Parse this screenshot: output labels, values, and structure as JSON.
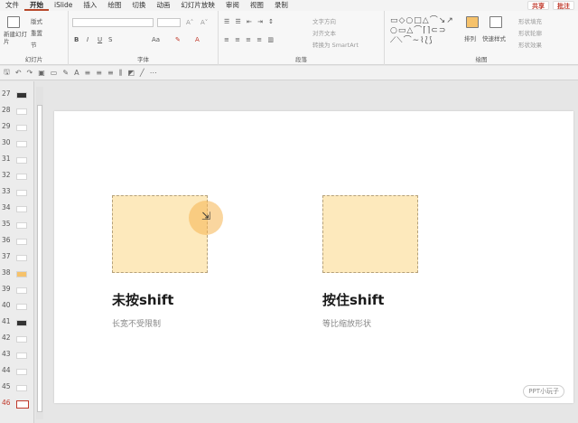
{
  "menu": {
    "items": [
      "文件",
      "开始",
      "iSlide",
      "插入",
      "绘图",
      "切换",
      "动画",
      "幻灯片放映",
      "审阅",
      "视图",
      "录制"
    ],
    "active_index": 1,
    "share": "共享",
    "comment": "批注"
  },
  "ribbon": {
    "slides_group": {
      "new_slide": "新建幻灯片",
      "layout": "版式",
      "reset": "重置",
      "section": "节",
      "label": "幻灯片"
    },
    "font_group": {
      "label": "字体",
      "bold": "B",
      "italic": "I",
      "underline": "U",
      "strike": "S",
      "aa": "Aa"
    },
    "paragraph_group": {
      "text_direction": "文字方向",
      "align_text": "对齐文本",
      "smartart": "转换为 SmartArt",
      "label": "段落"
    },
    "drawing_group": {
      "arrange": "排列",
      "quick_styles": "快速样式",
      "shape_fill": "形状填充",
      "shape_outline": "形状轮廓",
      "shape_effects": "形状效果",
      "label": "绘图"
    }
  },
  "thumbnails": [
    {
      "num": "27"
    },
    {
      "num": "28"
    },
    {
      "num": "29"
    },
    {
      "num": "30"
    },
    {
      "num": "31"
    },
    {
      "num": "32"
    },
    {
      "num": "33"
    },
    {
      "num": "34"
    },
    {
      "num": "35"
    },
    {
      "num": "36"
    },
    {
      "num": "37"
    },
    {
      "num": "38"
    },
    {
      "num": "39"
    },
    {
      "num": "40"
    },
    {
      "num": "41"
    },
    {
      "num": "42"
    },
    {
      "num": "43"
    },
    {
      "num": "44"
    },
    {
      "num": "45"
    },
    {
      "num": "46"
    }
  ],
  "slide": {
    "left": {
      "title": "未按shift",
      "subtitle": "长宽不受限制"
    },
    "right": {
      "title": "按住shift",
      "subtitle": "等比缩放形状"
    },
    "watermark": "PPT小玩子"
  },
  "colors": {
    "accent": "#b7472a",
    "rect_fill": "#fde9bc",
    "halo": "#f5b450"
  }
}
